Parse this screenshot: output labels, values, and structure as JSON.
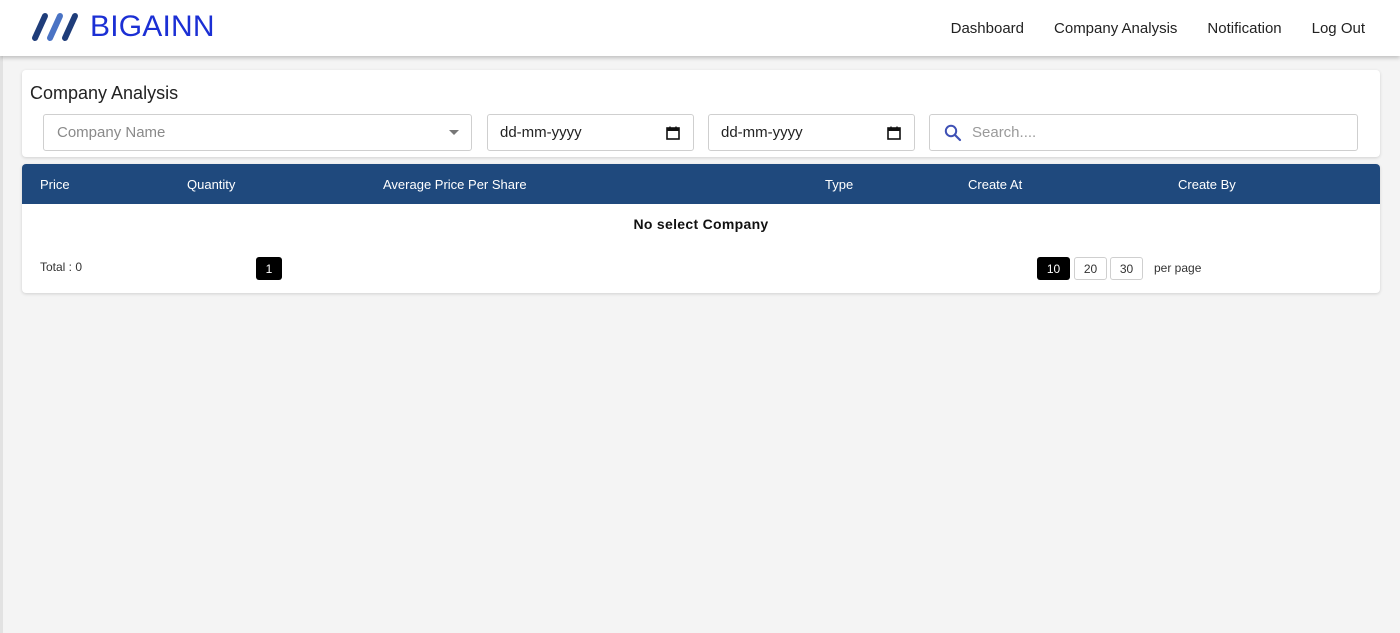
{
  "brand": {
    "name": "BIGAINN",
    "colors": {
      "name": "#1b2fd4",
      "stripe_dark": "#1f3d7a",
      "stripe_light": "#4a73c4"
    }
  },
  "nav": {
    "dashboard": "Dashboard",
    "company_analysis": "Company Analysis",
    "notification": "Notification",
    "logout": "Log Out"
  },
  "filters": {
    "title": "Company Analysis",
    "company_placeholder": "Company Name",
    "date_from": "dd-mm-yyyy",
    "date_to": "dd-mm-yyyy",
    "search_placeholder": "Search....",
    "icons": {
      "search": "search-icon",
      "calendar": "calendar-icon",
      "dropdown": "chevron-down-icon"
    }
  },
  "table": {
    "header_color": "#1f497d",
    "columns": [
      "Price",
      "Quantity",
      "Average Price Per Share",
      "Type",
      "Create At",
      "Create By"
    ],
    "empty_message": "No select Company",
    "total_label": "Total : 0",
    "current_page": "1",
    "page_sizes": [
      "10",
      "20",
      "30"
    ],
    "selected_page_size": "10",
    "per_page_label": "per page"
  }
}
